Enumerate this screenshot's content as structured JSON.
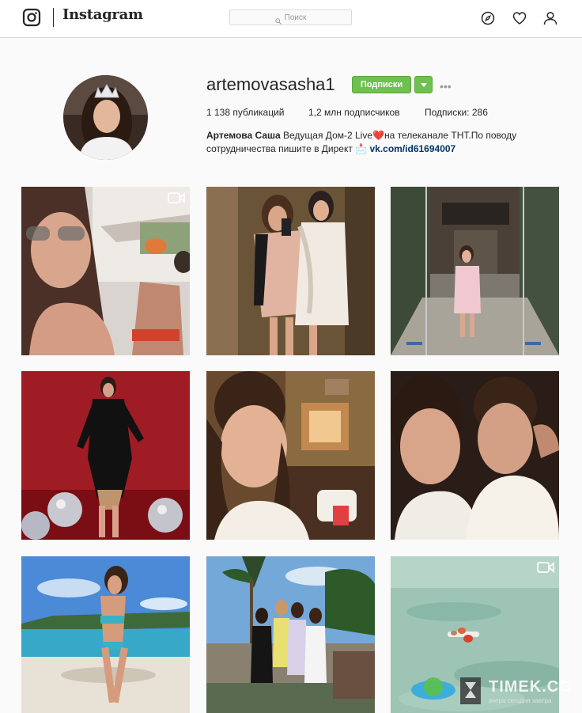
{
  "nav": {
    "logo_icon": "instagram-camera-icon",
    "wordmark": "Instagram",
    "search_placeholder": "Поиск",
    "icons": [
      "compass-icon",
      "heart-icon",
      "person-icon"
    ]
  },
  "profile": {
    "username": "artemovasasha1",
    "follow_label": "Подписки",
    "more_label": "•••",
    "stats": {
      "posts": "1 138 публикаций",
      "followers": "1,2 млн подписчиков",
      "following": "Подписки: 286"
    },
    "bio": {
      "name": "Артемова Саша",
      "text": " Ведущая Дом-2 Live❤️на телеканале ТНТ.По поводу сотрудничества пишите в Директ 📩 ",
      "link": "vk.com/id61694007"
    }
  },
  "grid": {
    "posts": [
      {
        "id": "post-1",
        "video": true
      },
      {
        "id": "post-2",
        "video": false
      },
      {
        "id": "post-3",
        "video": false
      },
      {
        "id": "post-4",
        "video": false
      },
      {
        "id": "post-5",
        "video": false
      },
      {
        "id": "post-6",
        "video": false
      },
      {
        "id": "post-7",
        "video": false
      },
      {
        "id": "post-8",
        "video": false
      },
      {
        "id": "post-9",
        "video": true
      }
    ]
  },
  "watermark": {
    "text": "TIMEK.CG",
    "subtext": "вчера сегодня завтра"
  },
  "colors": {
    "follow_green": "#70c050",
    "link_blue": "#003569",
    "border": "#dbdbdb"
  }
}
